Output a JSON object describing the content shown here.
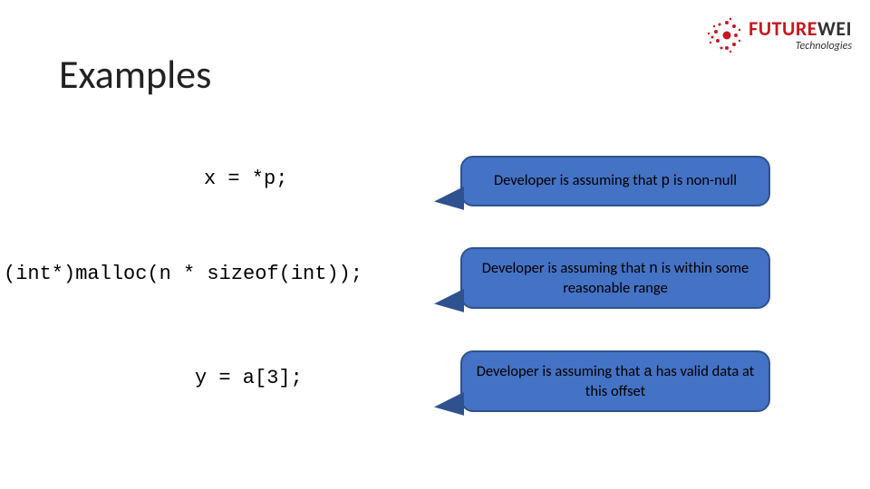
{
  "title": "Examples",
  "logo": {
    "brand_part1": "FUTURE",
    "brand_part2": "WEI",
    "subtitle": "Technologies"
  },
  "rows": [
    {
      "code": "x = *p;",
      "annotation_pre": "Developer is assuming that ",
      "annotation_var": "p",
      "annotation_post": " is non-null"
    },
    {
      "code": "(int*)malloc(n * sizeof(int));",
      "annotation_pre": "Developer is assuming that ",
      "annotation_var": "n",
      "annotation_post": " is within some reasonable range"
    },
    {
      "code": "y = a[3];",
      "annotation_pre": "Developer is assuming that ",
      "annotation_var": "a",
      "annotation_post": " has valid data at this offset"
    }
  ]
}
